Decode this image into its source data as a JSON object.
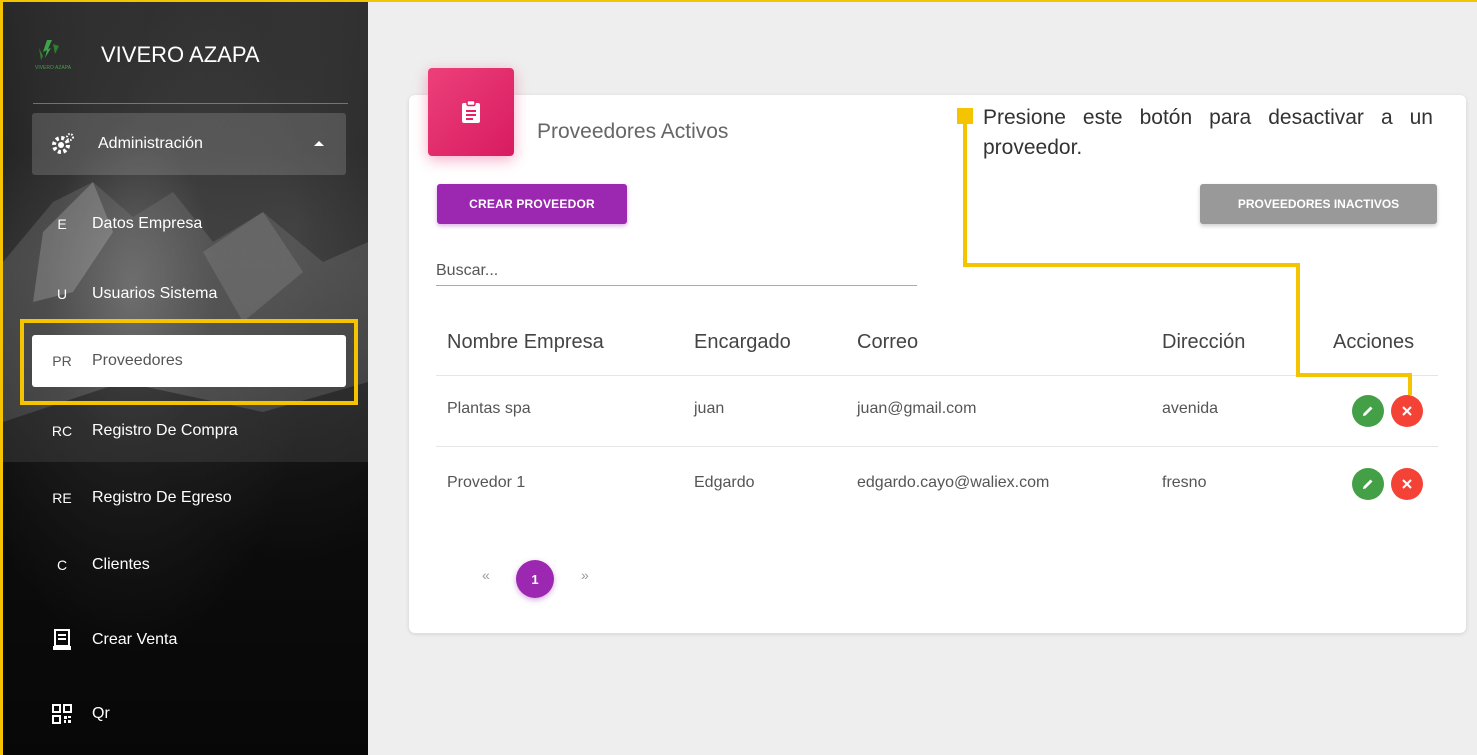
{
  "sidebar": {
    "brand": "VIVERO AZAPA",
    "admin": {
      "label": "Administración"
    },
    "items": [
      {
        "abbr": "E",
        "label": "Datos Empresa"
      },
      {
        "abbr": "U",
        "label": "Usuarios Sistema"
      },
      {
        "abbr": "PR",
        "label": "Proveedores"
      },
      {
        "abbr": "RC",
        "label": "Registro De Compra"
      },
      {
        "abbr": "RE",
        "label": "Registro De Egreso"
      },
      {
        "abbr": "C",
        "label": "Clientes"
      },
      {
        "icon": "receipt-icon",
        "label": "Crear Venta"
      },
      {
        "icon": "qr-code-icon",
        "label": "Qr"
      }
    ],
    "active_item": "Proveedores"
  },
  "card": {
    "title": "Proveedores Activos",
    "create_button": "CREAR PROVEEDOR",
    "inactive_button": "PROVEEDORES INACTIVOS",
    "search_placeholder": "Buscar..."
  },
  "table": {
    "headers": [
      "Nombre Empresa",
      "Encargado",
      "Correo",
      "Dirección",
      "Acciones"
    ],
    "rows": [
      [
        "Plantas spa",
        "juan",
        "juan@gmail.com",
        "avenida"
      ],
      [
        "Provedor 1",
        "Edgardo",
        "edgardo.cayo@waliex.com",
        "fresno"
      ]
    ]
  },
  "pagination": {
    "prev": "«",
    "current": "1",
    "next": "»"
  },
  "callout": {
    "text": "Presione este botón para desactivar a un proveedor."
  },
  "colors": {
    "highlight": "#f5c400",
    "primary": "#9c27b0",
    "card_icon": "#e91e63",
    "edit": "#43a047",
    "delete": "#f44336"
  }
}
